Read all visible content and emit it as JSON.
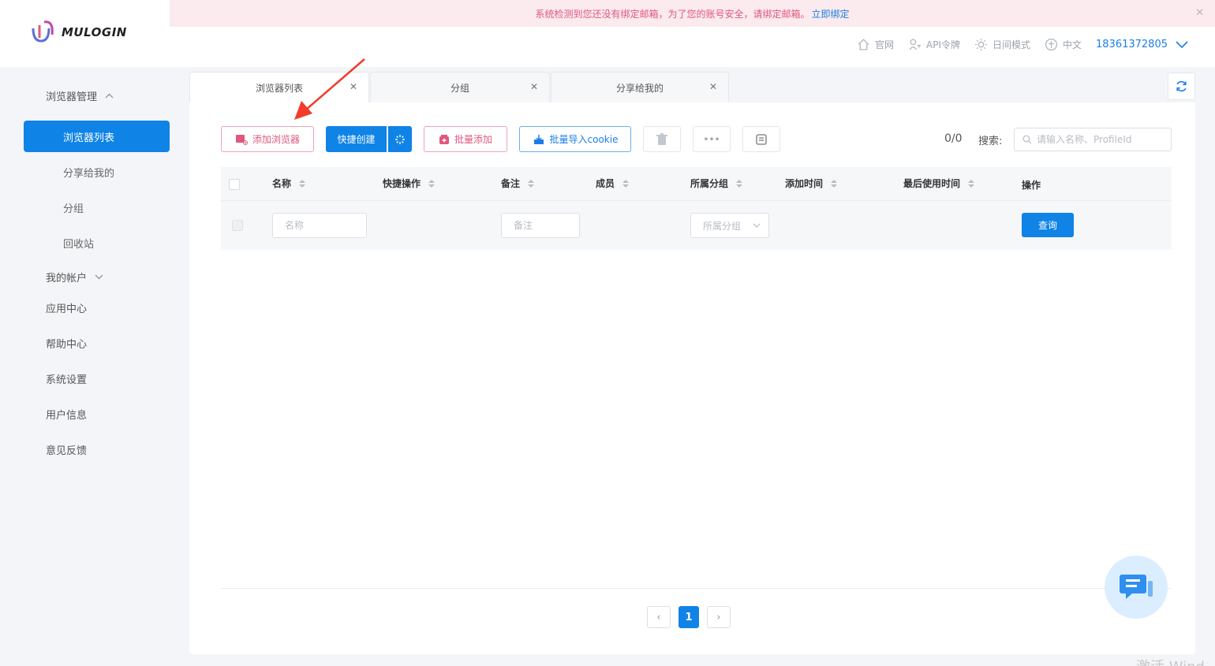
{
  "brand": {
    "name": "MULOGIN"
  },
  "notice": {
    "text": "系统检测到您还没有绑定邮箱，为了您的账号安全，请绑定邮箱。",
    "link": "立即绑定",
    "close": "✕"
  },
  "header": {
    "website": "官网",
    "api_token": "API令牌",
    "theme": "日间模式",
    "language": "中文",
    "user": "18361372805"
  },
  "sidebar": {
    "browser_mgmt": "浏览器管理",
    "items": [
      {
        "label": "浏览器列表",
        "active": true
      },
      {
        "label": "分享给我的"
      },
      {
        "label": "分组"
      },
      {
        "label": "回收站"
      }
    ],
    "my_account": "我的帐户",
    "app_center": "应用中心",
    "help_center": "帮助中心",
    "settings": "系统设置",
    "user_info": "用户信息",
    "feedback": "意见反馈"
  },
  "tabs": [
    {
      "label": "浏览器列表",
      "close": "✕"
    },
    {
      "label": "分组",
      "close": "✕"
    },
    {
      "label": "分享给我的",
      "close": "✕"
    }
  ],
  "toolbar": {
    "add_browser": "添加浏览器",
    "quick_create": "快捷创建",
    "batch_add": "批量添加",
    "import_cookie": "批量导入cookie",
    "more": "•••",
    "count": "0/0",
    "search_label": "搜索:",
    "search_placeholder": "请输入名称、ProfileId"
  },
  "table": {
    "columns": [
      "名称",
      "快捷操作",
      "备注",
      "成员",
      "所属分组",
      "添加时间",
      "最后使用时间",
      "操作"
    ],
    "filters": {
      "name_placeholder": "名称",
      "note_placeholder": "备注",
      "group_placeholder": "所属分组",
      "query": "查询"
    }
  },
  "pagination": {
    "prev": "‹",
    "current": "1",
    "next": "›"
  },
  "watermark": "激活 Wind",
  "colors": {
    "primary": "#0f83e6",
    "pink": "#e0577e",
    "notice_bg": "#fbeaee",
    "arrow": "#f23b2a"
  }
}
